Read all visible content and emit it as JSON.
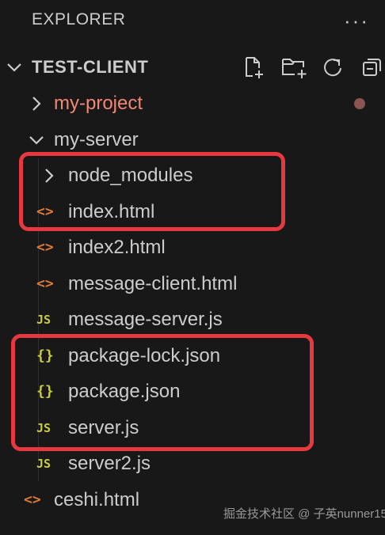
{
  "explorer": {
    "title": "EXPLORER",
    "more_label": "···"
  },
  "section": {
    "title": "TEST-CLIENT",
    "actions": [
      "new-file-icon",
      "new-folder-icon",
      "refresh-icon",
      "collapse-all-icon"
    ]
  },
  "tree": {
    "my_project": "my-project",
    "my_server": "my-server",
    "node_modules": "node_modules",
    "index_html": "index.html",
    "index2_html": "index2.html",
    "message_client_html": "message-client.html",
    "message_server_js": "message-server.js",
    "package_lock_json": "package-lock.json",
    "package_json": "package.json",
    "server_js": "server.js",
    "server2_js": "server2.js",
    "ceshi_html": "ceshi.html"
  },
  "icons": {
    "html_glyph": "<>",
    "js_glyph": "JS",
    "json_glyph": "{}"
  },
  "watermark": "掘金技术社区 @ 子英nunner15",
  "colors": {
    "background": "#181818",
    "text": "#cccccc",
    "modified": "#f48771",
    "html_icon": "#e37933",
    "js_icon": "#cbcb41",
    "highlight": "#e8383f"
  }
}
